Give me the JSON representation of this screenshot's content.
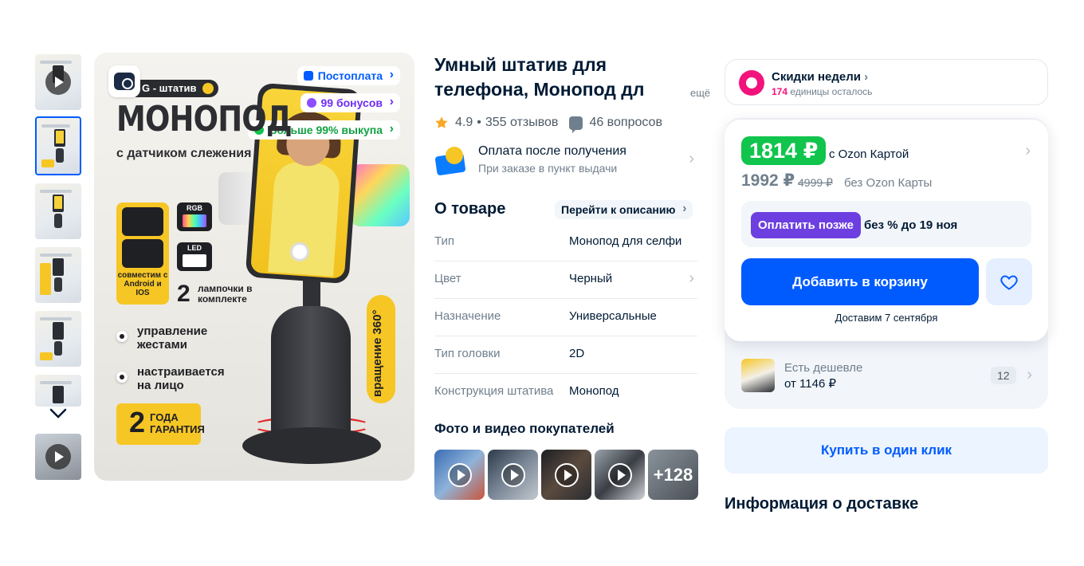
{
  "gallery": {
    "thumbnails": [
      {
        "kind": "video"
      },
      {
        "kind": "image",
        "selected": true
      },
      {
        "kind": "image"
      },
      {
        "kind": "image"
      },
      {
        "kind": "image"
      },
      {
        "kind": "image"
      },
      {
        "kind": "video"
      }
    ],
    "scroll_icon": "chevron-down-icon",
    "main_image": {
      "tag": "G - штатив",
      "badges": {
        "postpay": "Постоплата",
        "bonus": "99 бонусов",
        "ransom": "Больше 99% выкупа"
      },
      "headline": "МОНОПОД",
      "subheadline": "с датчиком слежения",
      "compat_label": "совместим с Android и IOS",
      "rgb_label": "RGB",
      "led_label": "LED",
      "lamps_count": "2",
      "lamps_text": "лампочки в комплекте",
      "feature_1": "управление жестами",
      "feature_2": "настраивается на лицо",
      "guarantee_num": "2",
      "guarantee_text": "ГОДА ГАРАНТИЯ",
      "rotation_text": "вращение 360°"
    }
  },
  "product": {
    "title": "Умный штатив для телефона, Монопод дл",
    "title_more": "ещё",
    "rating": "4.9",
    "reviews": "355 отзывов",
    "questions": "46 вопросов",
    "payment": {
      "title": "Оплата после получения",
      "subtitle": "При заказе в пункт выдачи"
    },
    "about_heading": "О товаре",
    "goto_description": "Перейти к описанию",
    "specs": [
      {
        "key": "Тип",
        "value": "Монопод для селфи"
      },
      {
        "key": "Цвет",
        "value": "Черный"
      },
      {
        "key": "Назначение",
        "value": "Универсальные"
      },
      {
        "key": "Тип головки",
        "value": "2D"
      },
      {
        "key": "Конструкция штатива",
        "value": "Монопод"
      }
    ],
    "photos_heading": "Фото и видео покупателей",
    "photos_more": "+128"
  },
  "sidebar": {
    "promo": {
      "title": "Скидки недели",
      "count": "174",
      "count_suffix": " единицы осталось"
    },
    "price_card_price": "1814 ₽",
    "price_card_price_label": "с Ozon Картой",
    "price_regular": "1992 ₽",
    "price_old": "4999 ₽",
    "price_regular_label": "без Ozon Карты",
    "pay_later_button": "Оплатить позже",
    "pay_later_text": "без % до 19 ноя",
    "add_to_cart": "Добавить в корзину",
    "delivery_date": "Доставим 7 сентября",
    "cheaper": {
      "line1": "Есть дешевле",
      "line2": "от 1146 ₽",
      "count": "12"
    },
    "one_click": "Купить в один клик",
    "delivery_heading": "Информация о доставке"
  },
  "colors": {
    "accent": "#005bff",
    "price_green": "#10c44c",
    "promo_pink": "#f2137c",
    "pay_later": "#6d3fe0"
  }
}
